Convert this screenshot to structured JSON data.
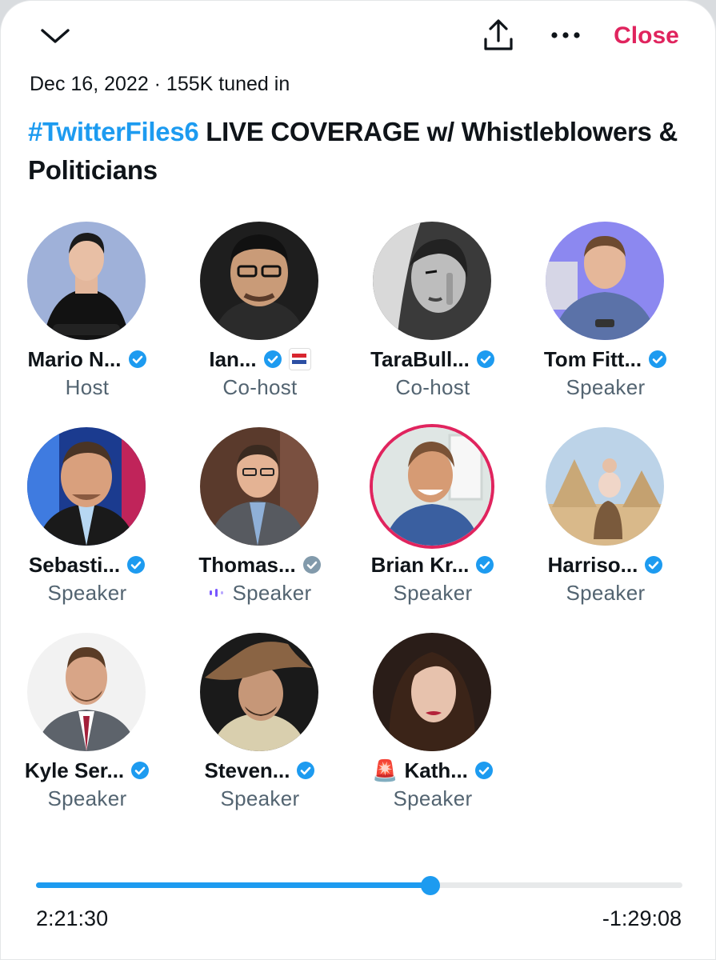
{
  "header": {
    "close_label": "Close",
    "meta": "Dec 16, 2022 · 155K tuned in",
    "title_hashtag": "#TwitterFiles6",
    "title_rest": " LIVE COVERAGE w/ Whistleblowers & Politicians"
  },
  "participants": [
    {
      "name": "Mario N...",
      "role": "Host",
      "verified": "blue"
    },
    {
      "name": "Ian...",
      "role": "Co-host",
      "verified": "blue",
      "affiliate_badge": true
    },
    {
      "name": "TaraBull...",
      "role": "Co-host",
      "verified": "blue"
    },
    {
      "name": "Tom Fitt...",
      "role": "Speaker",
      "verified": "blue"
    },
    {
      "name": "Sebasti...",
      "role": "Speaker",
      "verified": "blue"
    },
    {
      "name": "Thomas...",
      "role": "Speaker",
      "verified": "gray",
      "speaking_indicator": true
    },
    {
      "name": "Brian Kr...",
      "role": "Speaker",
      "verified": "blue",
      "highlighted_ring": true
    },
    {
      "name": "Harriso...",
      "role": "Speaker",
      "verified": "blue"
    },
    {
      "name": "Kyle Ser...",
      "role": "Speaker",
      "verified": "blue"
    },
    {
      "name": "Steven...",
      "role": "Speaker",
      "verified": "blue"
    },
    {
      "name": "Kath...",
      "role": "Speaker",
      "verified": "blue",
      "prefix_emoji": "🚨"
    }
  ],
  "playback": {
    "elapsed": "2:21:30",
    "remaining": "-1:29:08",
    "progress_fraction": 0.61
  },
  "colors": {
    "accent": "#1d9bf0",
    "close": "#e0245e",
    "verified_gray": "#829aab",
    "secondary_text": "#536471"
  },
  "icons": {
    "collapse": "chevron-down-icon",
    "share": "share-icon",
    "more": "more-icon",
    "verified": "verified-badge-icon"
  }
}
